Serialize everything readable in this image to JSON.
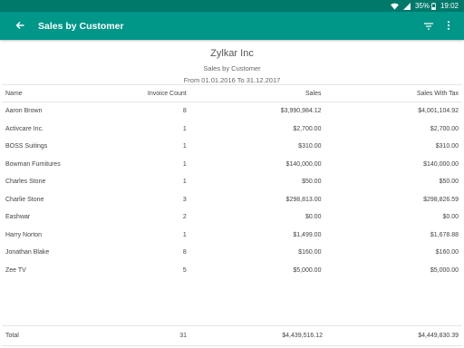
{
  "status_bar": {
    "battery": "35%",
    "time": "19:02"
  },
  "app_bar": {
    "title": "Sales by Customer"
  },
  "report": {
    "company": "Zylkar Inc",
    "name": "Sales by Customer",
    "period": "From 01.01.2016 To 31.12.2017"
  },
  "table": {
    "columns": [
      "Name",
      "Invoice Count",
      "Sales",
      "Sales With Tax"
    ],
    "rows": [
      [
        "Aaron Brown",
        "8",
        "$3,990,984.12",
        "$4,001,104.92"
      ],
      [
        "Activcare Inc.",
        "1",
        "$2,700.00",
        "$2,700.00"
      ],
      [
        "BOSS Suitings",
        "1",
        "$310.00",
        "$310.00"
      ],
      [
        "Bowman Furnitures",
        "1",
        "$140,000.00",
        "$140,000.00"
      ],
      [
        "Charles Stone",
        "1",
        "$50.00",
        "$50.00"
      ],
      [
        "Charlie Stone",
        "3",
        "$298,813.00",
        "$298,826.59"
      ],
      [
        "Eashwar",
        "2",
        "$0.00",
        "$0.00"
      ],
      [
        "Harry Norton",
        "1",
        "$1,499.00",
        "$1,678.88"
      ],
      [
        "Jonathan  Blake",
        "8",
        "$160.00",
        "$160.00"
      ],
      [
        "Zee TV",
        "5",
        "$5,000.00",
        "$5,000.00"
      ]
    ],
    "total": {
      "label": "Total",
      "invoice_count": "31",
      "sales": "$4,439,516.12",
      "sales_with_tax": "$4,449,830.39"
    }
  },
  "colors": {
    "status_bar": "#00796b",
    "app_bar": "#009688"
  }
}
